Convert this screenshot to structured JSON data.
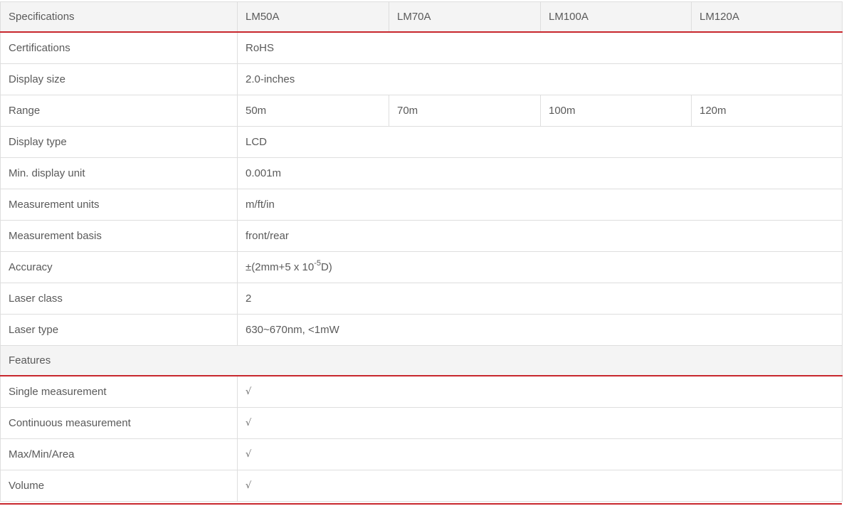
{
  "header": {
    "label": "Specifications",
    "models": [
      "LM50A",
      "LM70A",
      "LM100A",
      "LM120A"
    ]
  },
  "specs": [
    {
      "label": "Certifications",
      "value": "RoHS"
    },
    {
      "label": "Display size",
      "value": "2.0-inches"
    },
    {
      "label": "Range",
      "values": [
        "50m",
        "70m",
        "100m",
        "120m"
      ]
    },
    {
      "label": "Display type",
      "value": "LCD"
    },
    {
      "label": "Min. display unit",
      "value": "0.001m"
    },
    {
      "label": "Measurement units",
      "value": "m/ft/in"
    },
    {
      "label": "Measurement basis",
      "value": "front/rear"
    },
    {
      "label": "Accuracy",
      "value_prefix": "±(2mm+5 x 10",
      "value_sup": "-5",
      "value_suffix": "D)"
    },
    {
      "label": "Laser class",
      "value": "2"
    },
    {
      "label": "Laser type",
      "value": "630~670nm, <1mW"
    }
  ],
  "features_section": {
    "label": "Features"
  },
  "features": [
    {
      "label": "Single measurement",
      "value": "√"
    },
    {
      "label": "Continuous measurement",
      "value": "√"
    },
    {
      "label": "Max/Min/Area",
      "value": "√"
    },
    {
      "label": "Volume",
      "value": "√"
    }
  ],
  "colors": {
    "accent": "#c8272d",
    "header_bg": "#f4f4f4",
    "border": "#dedede",
    "text": "#5a5a5a"
  }
}
